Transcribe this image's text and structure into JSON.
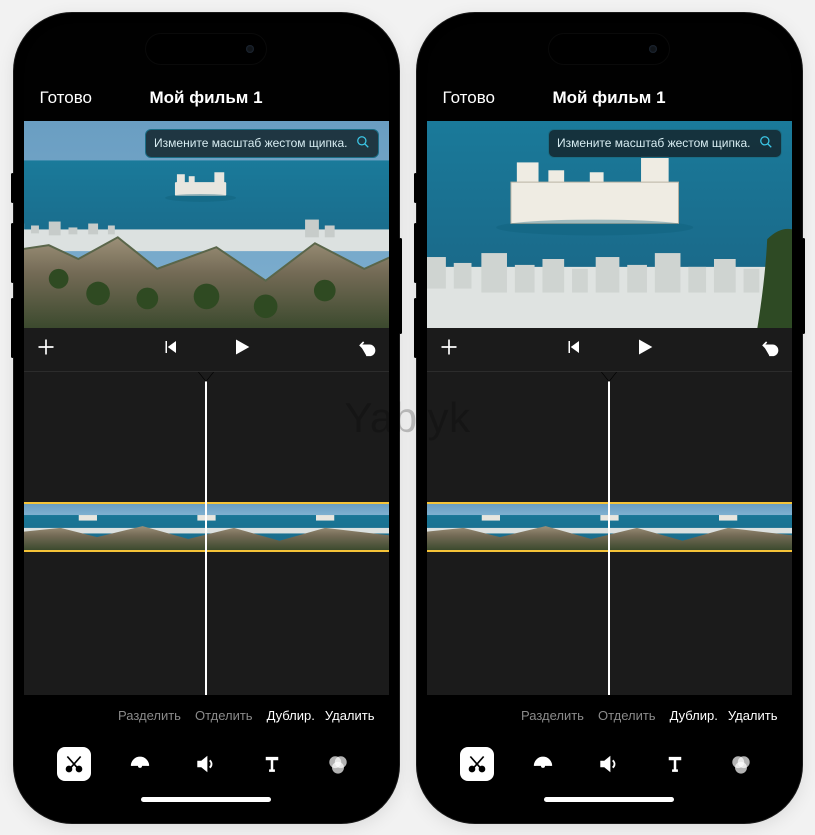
{
  "watermark": "Yablyk",
  "nav": {
    "done": "Готово",
    "title": "Мой фильм 1"
  },
  "hint": {
    "text": "Измените масштаб жестом щипка.",
    "icon": "magnify-icon"
  },
  "transport": {
    "add": "plus-icon",
    "prev": "skip-back-icon",
    "play": "play-icon",
    "undo": "undo-icon"
  },
  "actions": {
    "split": "Разделить",
    "detach": "Отделить",
    "duplicate": "Дублир.",
    "delete": "Удалить"
  },
  "tools": {
    "cut": "scissors-icon",
    "speed": "speedometer-icon",
    "volume": "volume-icon",
    "text": "text-icon",
    "filter": "filter-icon"
  }
}
